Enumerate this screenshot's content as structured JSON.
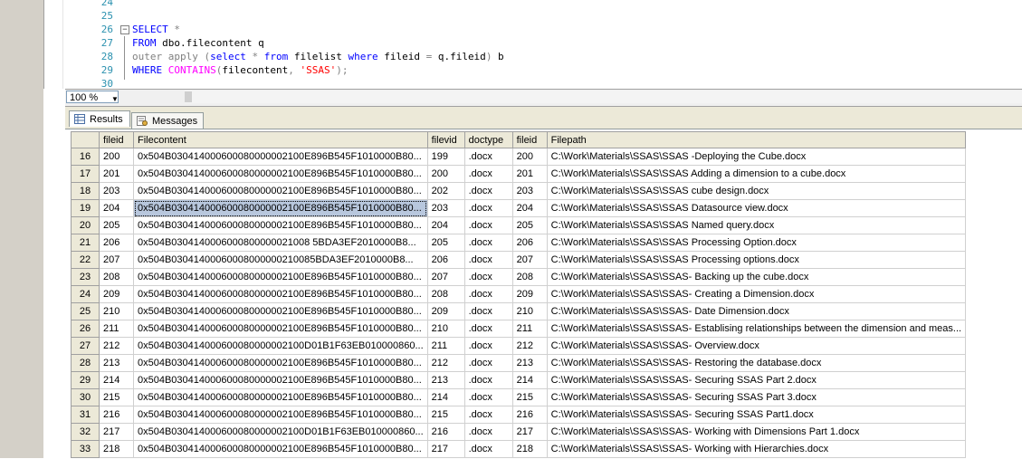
{
  "editor": {
    "lines": [
      {
        "num": "24",
        "code": []
      },
      {
        "num": "25",
        "code": []
      },
      {
        "num": "26",
        "fold": "−",
        "code": [
          {
            "c": "kw",
            "t": "SELECT"
          },
          {
            "c": "txt",
            "t": " "
          },
          {
            "c": "gray",
            "t": "*"
          }
        ]
      },
      {
        "num": "27",
        "code": [
          {
            "c": "kw",
            "t": "FROM"
          },
          {
            "c": "txt",
            "t": " dbo.filecontent q"
          }
        ]
      },
      {
        "num": "28",
        "code": [
          {
            "c": "gray",
            "t": "outer apply"
          },
          {
            "c": "txt",
            "t": " "
          },
          {
            "c": "gray",
            "t": "("
          },
          {
            "c": "kw",
            "t": "select"
          },
          {
            "c": "txt",
            "t": " "
          },
          {
            "c": "gray",
            "t": "*"
          },
          {
            "c": "txt",
            "t": " "
          },
          {
            "c": "kw",
            "t": "from"
          },
          {
            "c": "txt",
            "t": " filelist "
          },
          {
            "c": "kw",
            "t": "where"
          },
          {
            "c": "txt",
            "t": " fileid "
          },
          {
            "c": "gray",
            "t": "="
          },
          {
            "c": "txt",
            "t": " q.fileid"
          },
          {
            "c": "gray",
            "t": ")"
          },
          {
            "c": "txt",
            "t": " b"
          }
        ]
      },
      {
        "num": "29",
        "code": [
          {
            "c": "kw",
            "t": "WHERE"
          },
          {
            "c": "txt",
            "t": " "
          },
          {
            "c": "pink",
            "t": "CONTAINS"
          },
          {
            "c": "gray",
            "t": "("
          },
          {
            "c": "txt",
            "t": "filecontent"
          },
          {
            "c": "gray",
            "t": ","
          },
          {
            "c": "txt",
            "t": " "
          },
          {
            "c": "str",
            "t": "'SSAS'"
          },
          {
            "c": "gray",
            "t": ");"
          }
        ]
      },
      {
        "num": "30",
        "code": []
      }
    ]
  },
  "zoom": {
    "value": "100 %"
  },
  "tabs": {
    "results": "Results",
    "messages": "Messages"
  },
  "grid": {
    "columns": [
      "fileid",
      "Filecontent",
      "filevid",
      "doctype",
      "fileid",
      "Filepath"
    ],
    "selected_row": 3,
    "rows": [
      {
        "n": "16",
        "fileid": "200",
        "content": "0x504B030414000600080000002100E896B545F1010000B80...",
        "filevid": "199",
        "doctype": ".docx",
        "fileid2": "200",
        "path": "C:\\Work\\Materials\\SSAS\\SSAS -Deploying the Cube.docx"
      },
      {
        "n": "17",
        "fileid": "201",
        "content": "0x504B030414000600080000002100E896B545F1010000B80...",
        "filevid": "200",
        "doctype": ".docx",
        "fileid2": "201",
        "path": "C:\\Work\\Materials\\SSAS\\SSAS Adding a dimension to a cube.docx"
      },
      {
        "n": "18",
        "fileid": "203",
        "content": "0x504B030414000600080000002100E896B545F1010000B80...",
        "filevid": "202",
        "doctype": ".docx",
        "fileid2": "203",
        "path": "C:\\Work\\Materials\\SSAS\\SSAS cube design.docx"
      },
      {
        "n": "19",
        "fileid": "204",
        "content": "0x504B030414000600080000002100E896B545F1010000B80...",
        "filevid": "203",
        "doctype": ".docx",
        "fileid2": "204",
        "path": "C:\\Work\\Materials\\SSAS\\SSAS Datasource view.docx"
      },
      {
        "n": "20",
        "fileid": "205",
        "content": "0x504B030414000600080000002100E896B545F1010000B80...",
        "filevid": "204",
        "doctype": ".docx",
        "fileid2": "205",
        "path": "C:\\Work\\Materials\\SSAS\\SSAS Named query.docx"
      },
      {
        "n": "21",
        "fileid": "206",
        "content": "0x504B0304140006000800000021008 5BDA3EF2010000B8...",
        "filevid": "205",
        "doctype": ".docx",
        "fileid2": "206",
        "path": "C:\\Work\\Materials\\SSAS\\SSAS Processing Option.docx"
      },
      {
        "n": "22",
        "fileid": "207",
        "content": "0x504B03041400060008000000210085BDA3EF2010000B8...",
        "filevid": "206",
        "doctype": ".docx",
        "fileid2": "207",
        "path": "C:\\Work\\Materials\\SSAS\\SSAS Processing options.docx"
      },
      {
        "n": "23",
        "fileid": "208",
        "content": "0x504B030414000600080000002100E896B545F1010000B80...",
        "filevid": "207",
        "doctype": ".docx",
        "fileid2": "208",
        "path": "C:\\Work\\Materials\\SSAS\\SSAS- Backing up the cube.docx"
      },
      {
        "n": "24",
        "fileid": "209",
        "content": "0x504B030414000600080000002100E896B545F1010000B80...",
        "filevid": "208",
        "doctype": ".docx",
        "fileid2": "209",
        "path": "C:\\Work\\Materials\\SSAS\\SSAS- Creating a Dimension.docx"
      },
      {
        "n": "25",
        "fileid": "210",
        "content": "0x504B030414000600080000002100E896B545F1010000B80...",
        "filevid": "209",
        "doctype": ".docx",
        "fileid2": "210",
        "path": "C:\\Work\\Materials\\SSAS\\SSAS- Date Dimension.docx"
      },
      {
        "n": "26",
        "fileid": "211",
        "content": "0x504B030414000600080000002100E896B545F1010000B80...",
        "filevid": "210",
        "doctype": ".docx",
        "fileid2": "211",
        "path": "C:\\Work\\Materials\\SSAS\\SSAS- Establising relationships between the dimension and meas..."
      },
      {
        "n": "27",
        "fileid": "212",
        "content": "0x504B030414000600080000002100D01B1F63EB010000860...",
        "filevid": "211",
        "doctype": ".docx",
        "fileid2": "212",
        "path": "C:\\Work\\Materials\\SSAS\\SSAS- Overview.docx"
      },
      {
        "n": "28",
        "fileid": "213",
        "content": "0x504B030414000600080000002100E896B545F1010000B80...",
        "filevid": "212",
        "doctype": ".docx",
        "fileid2": "213",
        "path": "C:\\Work\\Materials\\SSAS\\SSAS- Restoring the database.docx"
      },
      {
        "n": "29",
        "fileid": "214",
        "content": "0x504B030414000600080000002100E896B545F1010000B80...",
        "filevid": "213",
        "doctype": ".docx",
        "fileid2": "214",
        "path": "C:\\Work\\Materials\\SSAS\\SSAS- Securing SSAS Part 2.docx"
      },
      {
        "n": "30",
        "fileid": "215",
        "content": "0x504B030414000600080000002100E896B545F1010000B80...",
        "filevid": "214",
        "doctype": ".docx",
        "fileid2": "215",
        "path": "C:\\Work\\Materials\\SSAS\\SSAS- Securing SSAS Part 3.docx"
      },
      {
        "n": "31",
        "fileid": "216",
        "content": "0x504B030414000600080000002100E896B545F1010000B80...",
        "filevid": "215",
        "doctype": ".docx",
        "fileid2": "216",
        "path": "C:\\Work\\Materials\\SSAS\\SSAS- Securing SSAS Part1.docx"
      },
      {
        "n": "32",
        "fileid": "217",
        "content": "0x504B030414000600080000002100D01B1F63EB010000860...",
        "filevid": "216",
        "doctype": ".docx",
        "fileid2": "217",
        "path": "C:\\Work\\Materials\\SSAS\\SSAS- Working with Dimensions Part 1.docx"
      },
      {
        "n": "33",
        "fileid": "218",
        "content": "0x504B030414000600080000002100E896B545F1010000B80...",
        "filevid": "217",
        "doctype": ".docx",
        "fileid2": "218",
        "path": "C:\\Work\\Materials\\SSAS\\SSAS- Working with Hierarchies.docx"
      }
    ]
  }
}
